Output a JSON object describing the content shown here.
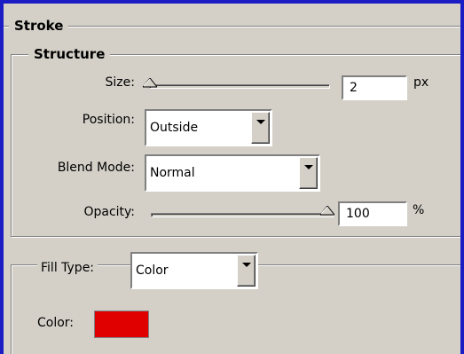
{
  "stroke": {
    "title": "Stroke",
    "structure": {
      "title": "Structure",
      "size": {
        "label": "Size:",
        "value": "2",
        "unit": "px",
        "level": 0.0
      },
      "position": {
        "label": "Position:",
        "selected": "Outside"
      },
      "blend_mode": {
        "label": "Blend Mode:",
        "selected": "Normal"
      },
      "opacity": {
        "label": "Opacity:",
        "value": "100",
        "unit": "%",
        "level": 1.0
      }
    },
    "fill": {
      "type_label": "Fill Type:",
      "type_selected": "Color",
      "color_label": "Color:",
      "color_value": "#e00000"
    }
  },
  "colors": {
    "window_border": "#1c1cc4",
    "panel_bg": "#d4d0c8"
  },
  "icons": {
    "dropdown": "chevron-down-icon",
    "slider_thumb": "triangle-thumb-icon"
  }
}
